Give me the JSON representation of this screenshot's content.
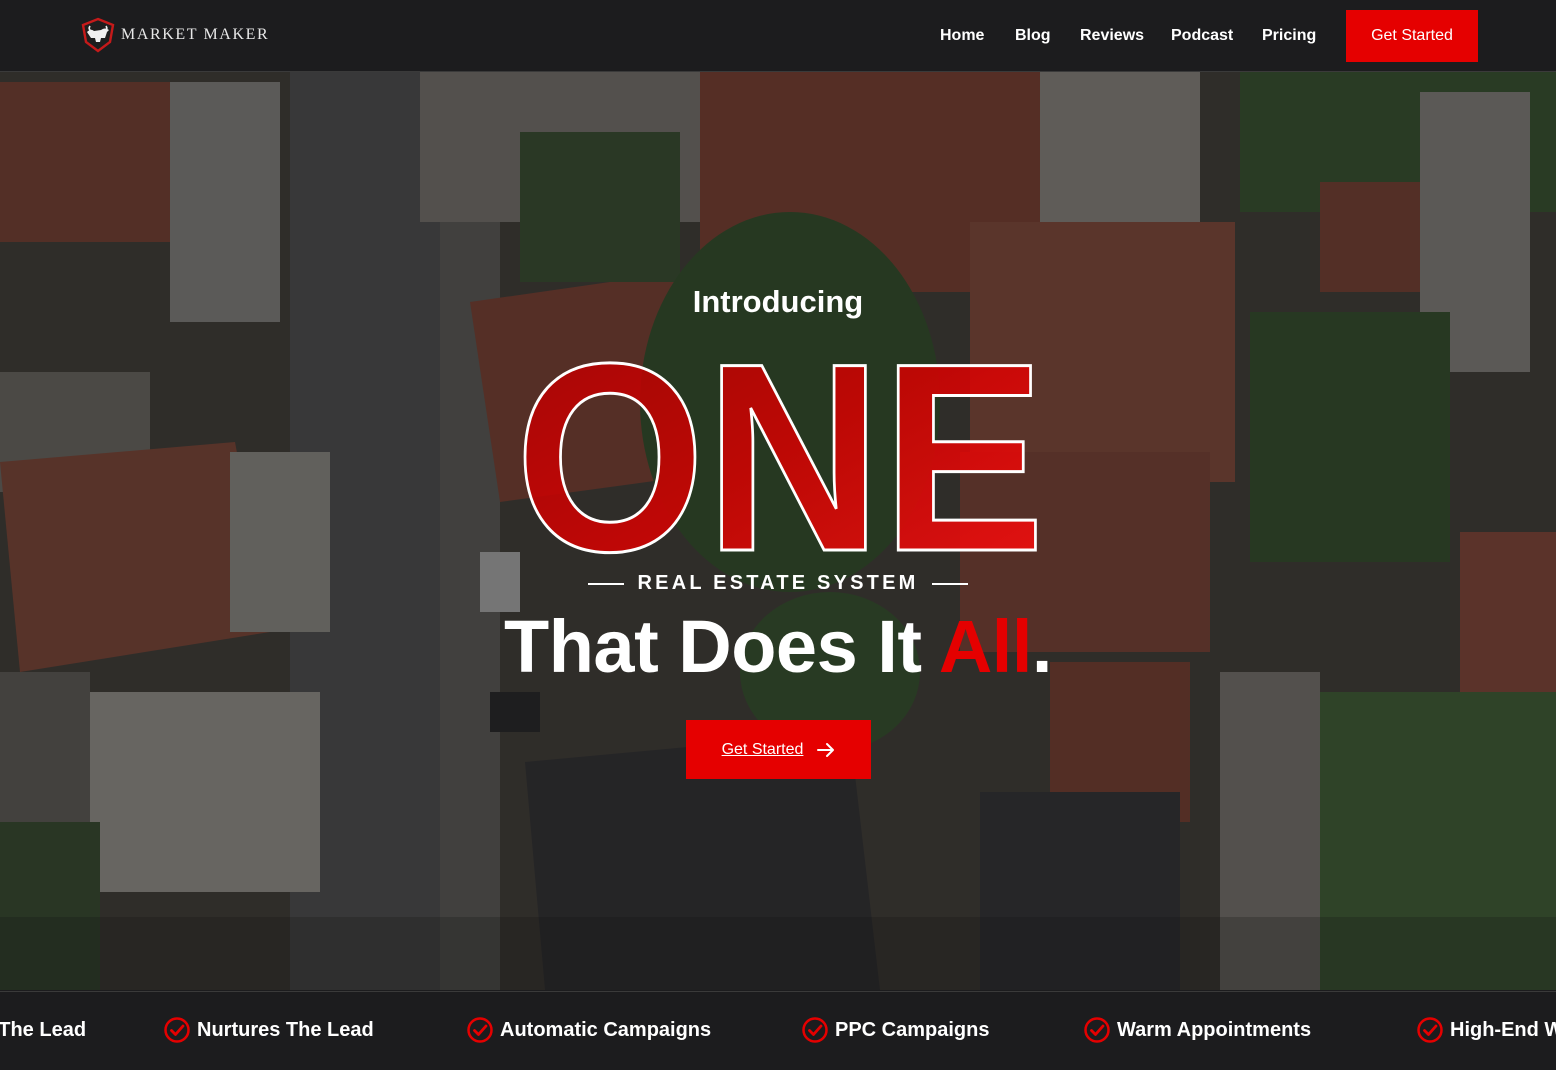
{
  "header": {
    "brand": "MARKET MAKER",
    "nav": [
      "Home",
      "Blog",
      "Reviews",
      "Podcast",
      "Pricing"
    ],
    "cta_label": "Get Started"
  },
  "hero": {
    "intro": "Introducing",
    "big_word": "ONE",
    "subtitle": "REAL ESTATE SYSTEM",
    "headline_main": "That Does It ",
    "headline_accent": "All",
    "headline_end": ".",
    "cta_label": "Get Started",
    "cta_icon": "arrow-right-icon"
  },
  "ticker": {
    "items": [
      "Captures The Lead",
      "Nurtures The Lead",
      "Automatic Campaigns",
      "PPC Campaigns",
      "Warm Appointments",
      "High-End Website"
    ],
    "icon": "check-circle-icon"
  },
  "colors": {
    "accent": "#e50000",
    "background": "#1c1c1e",
    "text": "#ffffff"
  }
}
